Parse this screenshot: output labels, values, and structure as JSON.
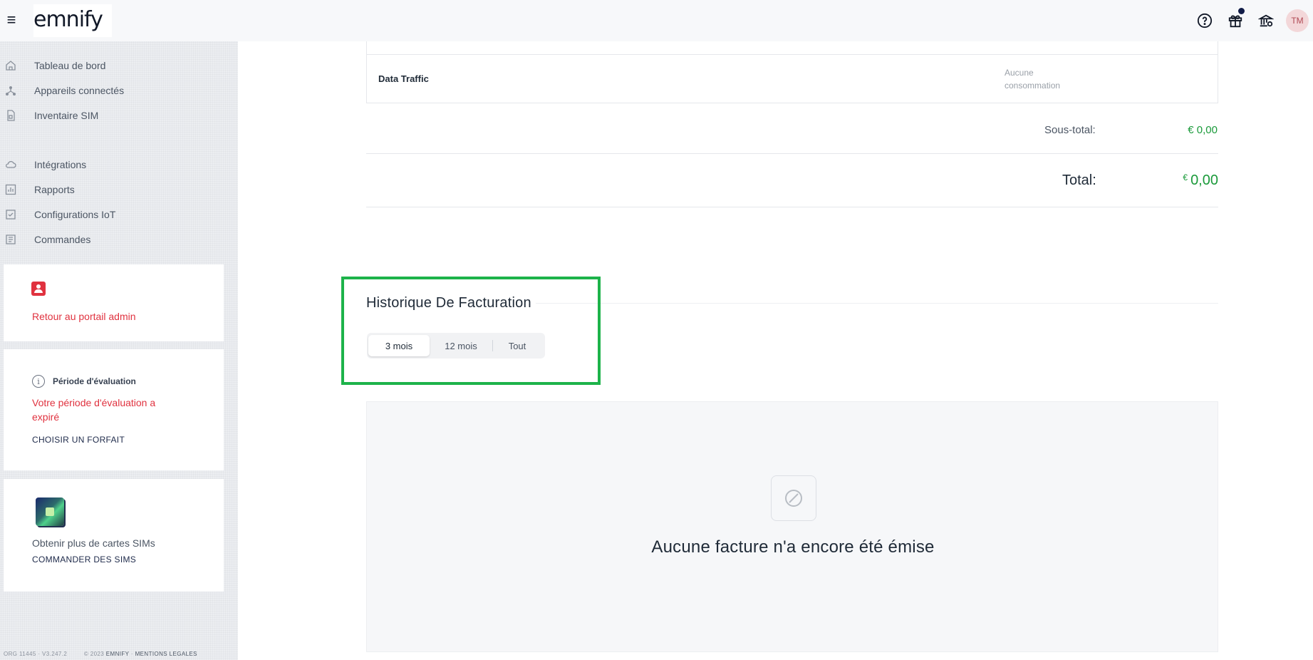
{
  "app": {
    "logo": "emnify",
    "avatar_initials": "TM"
  },
  "topbar": {
    "icons": [
      "help-icon",
      "gift-icon",
      "bank-icon"
    ],
    "accent": "#111c47"
  },
  "sidebar": {
    "items": [
      {
        "label": "Tableau de bord",
        "icon": "home-icon"
      },
      {
        "label": "Appareils connectés",
        "icon": "devices-icon"
      },
      {
        "label": "Inventaire SIM",
        "icon": "sim-icon"
      },
      {
        "label": "Intégrations",
        "icon": "cloud-icon"
      },
      {
        "label": "Rapports",
        "icon": "chart-icon"
      },
      {
        "label": "Configurations IoT",
        "icon": "checklist-icon"
      },
      {
        "label": "Commandes",
        "icon": "orders-icon"
      }
    ],
    "admin": {
      "link": "Retour au portail admin"
    },
    "evaluation": {
      "title": "Période d'évaluation",
      "message": "Votre période d'évaluation a expiré",
      "cta": "CHOISIR UN FORFAIT"
    },
    "sims": {
      "text": "Obtenir plus de cartes SIMs",
      "cta": "COMMANDER DES SIMS"
    },
    "footer": {
      "org": "ORG 11445 · V3.247.2",
      "copyright": "© 2023",
      "company": "EMNIFY",
      "sep": "·",
      "legal": "MENTIONS LEGALES"
    }
  },
  "billing": {
    "usage_name": "Data Traffic",
    "usage_value": "Aucune consommation",
    "subtotal_label": "Sous-total:",
    "subtotal_value": "€ 0,00",
    "total_label": "Total:",
    "total_currency": "€",
    "total_value": "0,00",
    "value_color": "#1a9a3a"
  },
  "history": {
    "title": "Historique De Facturation",
    "tabs": [
      "3 mois",
      "12 mois",
      "Tout"
    ],
    "selected": "3 mois",
    "empty_message": "Aucune facture n'a encore été émise",
    "highlight_color": "#1db34a"
  }
}
